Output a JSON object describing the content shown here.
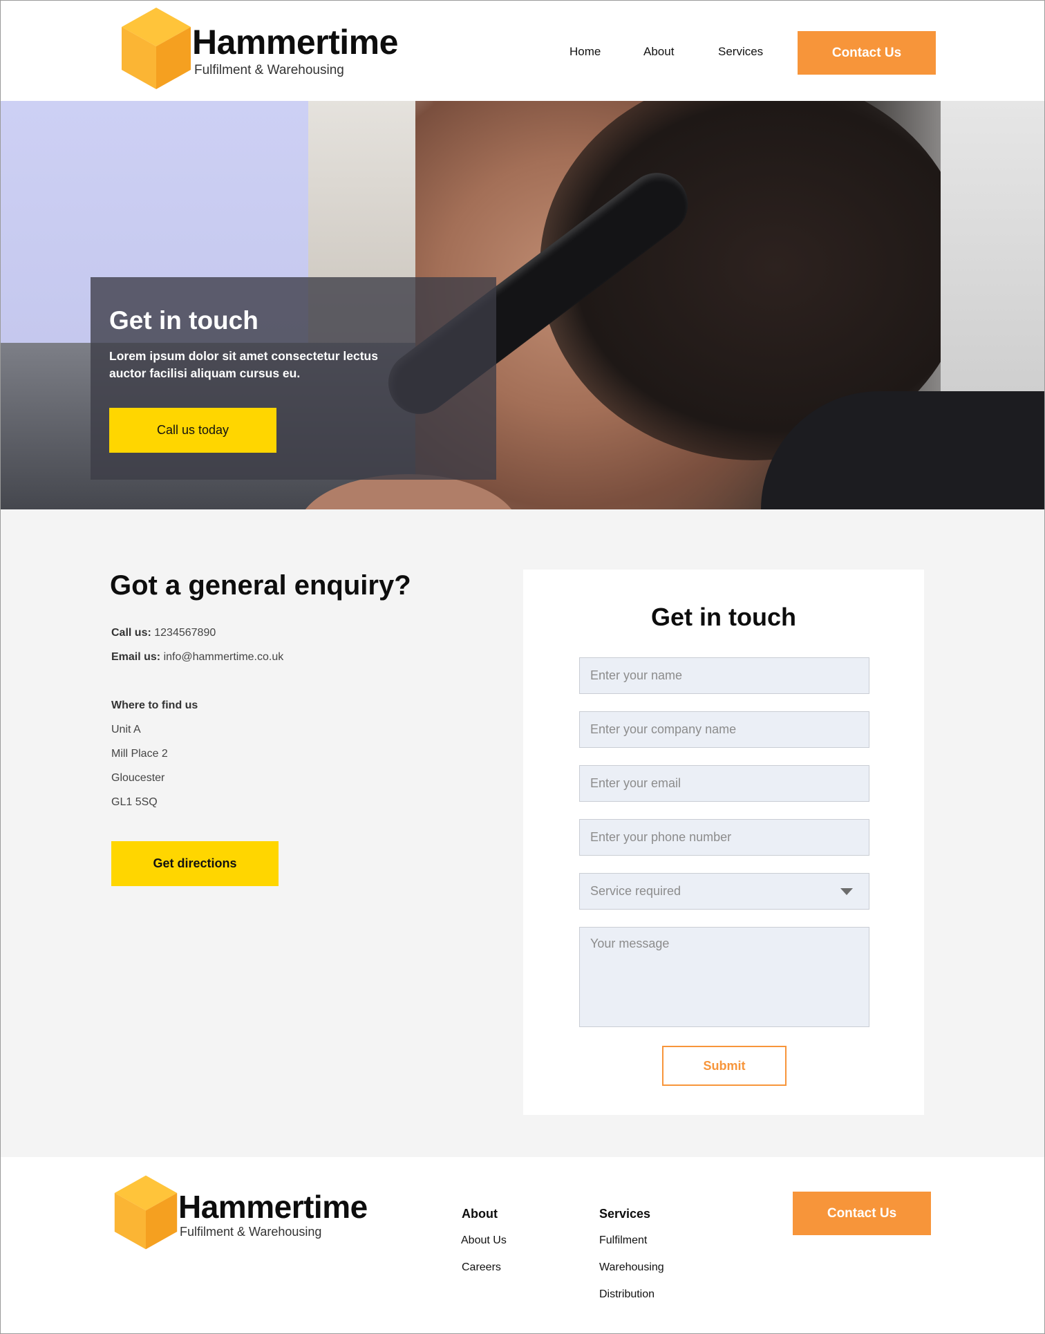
{
  "brand": {
    "name": "Hammertime",
    "tagline": "Fulfilment & Warehousing",
    "colors": {
      "orange": "#f7953a",
      "yellow": "#ffd600",
      "cube_light": "#ffc43a",
      "cube_dark": "#f5a623"
    }
  },
  "nav": {
    "items": [
      "Home",
      "About",
      "Services"
    ],
    "cta": "Contact Us"
  },
  "hero": {
    "title": "Get in touch",
    "text": "Lorem ipsum dolor sit amet consectetur lectus auctor facilisi aliquam cursus eu.",
    "button": "Call us today"
  },
  "enquiry": {
    "title": "Got a general enquiry?",
    "call_label": "Call us:",
    "call_value": "1234567890",
    "email_label": "Email us:",
    "email_value": "info@hammertime.co.uk",
    "find_label": "Where to find us",
    "address": [
      "Unit A",
      "Mill Place 2",
      "Gloucester",
      "GL1 5SQ"
    ],
    "button": "Get directions"
  },
  "form": {
    "title": "Get in touch",
    "fields": {
      "name": "Enter your name",
      "company": "Enter your company name",
      "email": "Enter your email",
      "phone": "Enter your phone number",
      "service": "Service required",
      "message": "Your message"
    },
    "submit": "Submit"
  },
  "footer": {
    "about_title": "About",
    "about_links": [
      "About Us",
      "Careers"
    ],
    "services_title": "Services",
    "services_links": [
      "Fulfilment",
      "Warehousing",
      "Distribution"
    ],
    "cta": "Contact Us"
  }
}
